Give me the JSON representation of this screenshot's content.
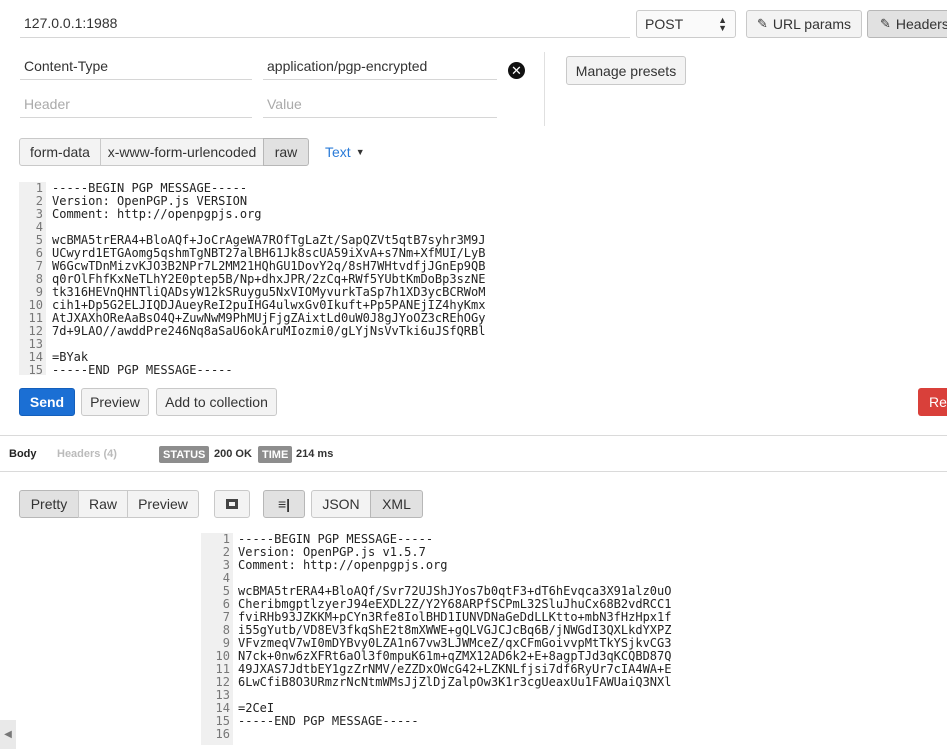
{
  "request": {
    "url": "127.0.0.1:1988",
    "method": "POST",
    "url_params_label": "URL params",
    "headers_label": "Headers",
    "manage_presets_label": "Manage presets",
    "header_row": {
      "key": "Content-Type",
      "value": "application/pgp-encrypted"
    },
    "header_placeholder": {
      "key": "Header",
      "value": "Value"
    },
    "body_tabs": [
      "form-data",
      "x-www-form-urlencoded",
      "raw"
    ],
    "body_type": "Text",
    "body_lines": [
      "-----BEGIN PGP MESSAGE-----",
      "Version: OpenPGP.js VERSION",
      "Comment: http://openpgpjs.org",
      "",
      "wcBMA5trERA4+BloAQf+JoCrAgeWA7ROfTgLaZt/SapQZVt5qtB7syhr3M9J",
      "UCwyrd1ETGAomg5qshmTgNBT27alBH61Jk8scUA59iXvA+s7Nm+XfMUI/LyB",
      "W6GcwTDnMizvKJO3B2NPr7L2MM21HQhGU1DovY2q/8sH7WHtvdfjJGnEp9QB",
      "q0rOlFhfKxNeTLhY2E0ptep5B/Np+dhxJPR/2zCq+RWf5YUbtKmDoBp3szNE",
      "tk316HEVnQHNTliQADsyW12kSRuygu5NxVIOMyvurkTaSp7h1XD3ycBCRWoM",
      "cih1+Dp5G2ELJIQDJAueyReI2puIHG4ulwxGv0Ikuft+Pp5PANEjIZ4hyKmx",
      "AtJXAXhOReAaBsO4Q+ZuwNwM9PhMUjFjgZAixtLd0uW0J8gJYoOZ3cREhOGy",
      "7d+9LAO//awddPre246Nq8aSaU6okAruMIozmi0/gLYjNsVvTki6uJSfQRBl",
      "",
      "=BYak",
      "-----END PGP MESSAGE-----"
    ],
    "send_label": "Send",
    "preview_label": "Preview",
    "add_to_collection_label": "Add to collection",
    "reset_label": "Re"
  },
  "response": {
    "tab_body": "Body",
    "tab_headers": "Headers (4)",
    "status_label": "STATUS",
    "status_value": "200 OK",
    "time_label": "TIME",
    "time_value": "214 ms",
    "view_modes": [
      "Pretty",
      "Raw",
      "Preview"
    ],
    "formats": [
      "JSON",
      "XML"
    ],
    "body_lines": [
      "-----BEGIN PGP MESSAGE-----",
      "Version: OpenPGP.js v1.5.7",
      "Comment: http://openpgpjs.org",
      "",
      "wcBMA5trERA4+BloAQf/Svr72UJShJYos7b0qtF3+dT6hEvqca3X91alz0uO",
      "CheribmgptlzyerJ94eEXDL2Z/Y2Y68ARPfSCPmL32SluJhuCx68B2vdRCC1",
      "fviRHb93JZKKM+pCYn3Rfe8IolBHD1IUNVDNaGeDdLLKtto+mbN3fHzHpx1f",
      "i55gYutb/VD8EV3fkqShE2t8mXWWE+gQLVGJCJcBq6B/jNWGdI3QXLkdYXPZ",
      "VFvzmeqV7wI0mDYBvy0LZA1n67vw3LJWMceZ/qxCFmGoivvpMtTkYSjkvCG3",
      "N7ck+0nw6zXFRt6aOl3f0mpuK61m+qZMX12AD6k2+E+8agpTJd3qKCQBD87Q",
      "49JXAS7JdtbEY1gzZrNMV/eZZDxOWcG42+LZKNLfjsi7df6RyUr7cIA4WA+E",
      "6LwCfiB8O3URmzrNcNtmWMsJjZlDjZalpOw3K1r3cgUeaxUu1FAWUaiQ3NXl",
      "",
      "=2CeI",
      "-----END PGP MESSAGE-----",
      ""
    ]
  }
}
